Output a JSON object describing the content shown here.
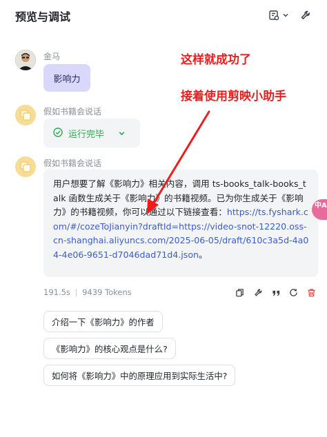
{
  "header": {
    "title": "预览与调试",
    "menu_icon": "document-settings-icon",
    "menu_chevron_icon": "chevron-down-icon",
    "tool_icon": "wrench-icon"
  },
  "conversation": {
    "user": {
      "name": "金马",
      "message": "影响力"
    },
    "bot_status": {
      "name": "假如书籍会说话",
      "status_icon": "check-circle-icon",
      "status_text": "运行完毕",
      "expand_icon": "chevron-down-icon",
      "status_color": "#2fa84f"
    },
    "bot_reply": {
      "name": "假如书籍会说话",
      "text_before": "用户想要了解《影响力》相关内容，调用 ts-books_talk-books_talk 函数生成关于《影响力》的书籍视频。已为你生成关于《影响力》的书籍视频，你可以通过以下链接查看：",
      "link": "https://ts.fyshark.com/#/cozeToJianyin?draftId=https://video-snot-12220.oss-cn-shanghai.aliyuncs.com/2025-06-05/draft/610c3a5d-4a04-4e06-9651-d7046dad71d4.json",
      "text_after": "。",
      "link_color": "#3b5cc9"
    },
    "meta": {
      "duration": "191.5s",
      "separator": "|",
      "tokens": "9439 Tokens"
    },
    "actions": [
      {
        "icon": "copy-icon"
      },
      {
        "icon": "wrench-icon"
      },
      {
        "icon": "quote-icon"
      },
      {
        "icon": "refresh-icon"
      },
      {
        "icon": "trash-icon",
        "color": "#e5483d"
      }
    ],
    "suggestions": [
      "介绍一下《影响力》的作者",
      "《影响力》的核心观点是什么?",
      "如何将《影响力》中的原理应用到实际生活中?"
    ]
  },
  "annotations": {
    "line1": "这样就成功了",
    "line2": "接着使用剪映小助手",
    "color": "#ee1c1c"
  },
  "side_tab": {
    "label": "中A"
  }
}
